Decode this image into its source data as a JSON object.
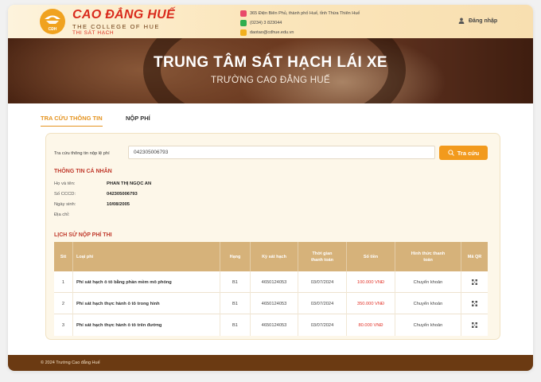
{
  "header": {
    "brand_name": "CAO ĐẲNG HUẾ",
    "brand_sub": "THE COLLEGE OF HUE",
    "brand_sub2": "THI SÁT HẠCH",
    "logo_text": "CĐH",
    "contacts": [
      {
        "icon": "location-icon",
        "color": "#e84a6a",
        "text": "365 Điện Biên Phủ, thành phố Huế, tỉnh Thừa Thiên Huế"
      },
      {
        "icon": "phone-icon",
        "color": "#2fae4f",
        "text": "(0234) 3 823044"
      },
      {
        "icon": "mail-icon",
        "color": "#f2b01e",
        "text": "daotao@cdhue.edu.vn"
      }
    ],
    "login_label": "Đăng nhập"
  },
  "banner": {
    "title": "TRUNG TÂM SÁT HẠCH LÁI XE",
    "subtitle": "TRƯỜNG CAO ĐẲNG HUẾ"
  },
  "tabs": [
    {
      "label": "TRA CỨU THÔNG TIN",
      "active": true
    },
    {
      "label": "NỘP PHÍ",
      "active": false
    }
  ],
  "search": {
    "label": "Tra cứu thông tin nộp lệ phí",
    "value": "042305006793",
    "button_label": "Tra cứu"
  },
  "personal": {
    "title": "THÔNG TIN CÁ NHÂN",
    "rows": [
      {
        "label": "Họ và tên:",
        "value": "PHAN THỊ NGỌC AN"
      },
      {
        "label": "Số CCCD:",
        "value": "042305006793"
      },
      {
        "label": "Ngày sinh:",
        "value": "10/08/2005"
      },
      {
        "label": "Địa chỉ:",
        "value": ""
      }
    ]
  },
  "history": {
    "title": "LỊCH SỬ NỘP PHÍ THI",
    "columns": [
      "Stt",
      "Loại phí",
      "Hạng",
      "Kỳ sát hạch",
      "Thời gian thanh toán",
      "Số tiền",
      "Hình thức thanh toán",
      "Mã QR"
    ],
    "rows": [
      [
        "1",
        "Phí sát hạch ô tô bằng phần mềm mô phỏng",
        "B1",
        "4650124053",
        "03/07/2024",
        "100.000 VNĐ",
        "Chuyển khoản"
      ],
      [
        "2",
        "Phí sát hạch thực hành ô tô trong hình",
        "B1",
        "4650124053",
        "03/07/2024",
        "350.000 VNĐ",
        "Chuyển khoản"
      ],
      [
        "3",
        "Phí sát hạch thực hành ô tô trên đường",
        "B1",
        "4650124053",
        "03/07/2024",
        "80.000 VNĐ",
        "Chuyển khoản"
      ]
    ],
    "qr_icon": "qr-code-icon"
  },
  "footer": {
    "text": "© 2024 Trường Cao đẳng Huế"
  },
  "colors": {
    "accent": "#f29a1d",
    "brand_red": "#d92a1c",
    "table_header": "#d6b27a",
    "footer": "#6b3a12",
    "money": "#e2342a"
  }
}
